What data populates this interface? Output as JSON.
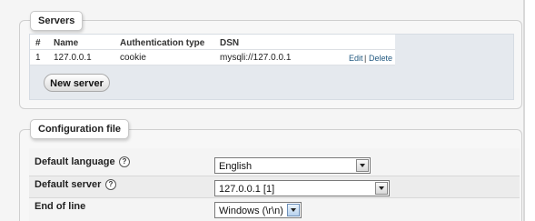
{
  "servers": {
    "legend": "Servers",
    "columns": [
      "#",
      "Name",
      "Authentication type",
      "DSN"
    ],
    "rows": [
      {
        "index": "1",
        "name": "127.0.0.1",
        "auth_type": "cookie",
        "dsn": "mysqli://127.0.0.1",
        "edit": "Edit",
        "separator": "|",
        "delete": "Delete"
      }
    ],
    "new_server_label": "New server"
  },
  "config": {
    "legend": "Configuration file",
    "fields": [
      {
        "label": "Default language",
        "value": "English",
        "help": "?"
      },
      {
        "label": "Default server",
        "value": "127.0.0.1 [1]",
        "help": "?"
      },
      {
        "label": "End of line",
        "value": "Windows (\\r\\n)"
      }
    ]
  },
  "colors": {
    "link": "#235a81",
    "panel": "#e5e9ee",
    "active_arrow": "#b8d2ee"
  },
  "icons": {
    "help": "help-icon",
    "dropdown": "chevron-down-icon"
  }
}
